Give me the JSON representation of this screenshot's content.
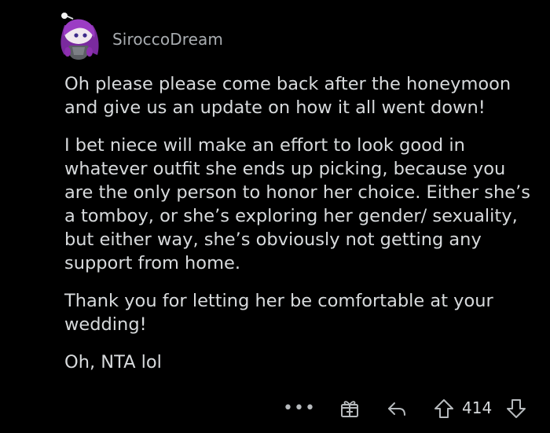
{
  "comment": {
    "username": "SiroccoDream",
    "paragraphs": [
      "Oh please please come back after the honeymoon and give us an update on how it all went down!",
      "I bet niece will make an effort to look good in whatever outfit she ends up picking, because you are the only person to honor her choice.  Either she’s a tomboy, or she’s exploring her gender/ sexuality, but either way, she’s obviously not getting any support from home.",
      "Thank you for letting her be comfortable at your wedding!",
      "Oh, NTA lol"
    ],
    "actions": {
      "more_label": "•••",
      "score": "414",
      "icons": [
        "more-icon",
        "award-icon",
        "reply-icon",
        "upvote-icon",
        "downvote-icon"
      ]
    }
  },
  "colors": {
    "background": "#000000",
    "text": "#d7dadc",
    "username": "#a9adb1",
    "icon": "#b6babd",
    "avatar_hair": "#8d2fb0"
  }
}
